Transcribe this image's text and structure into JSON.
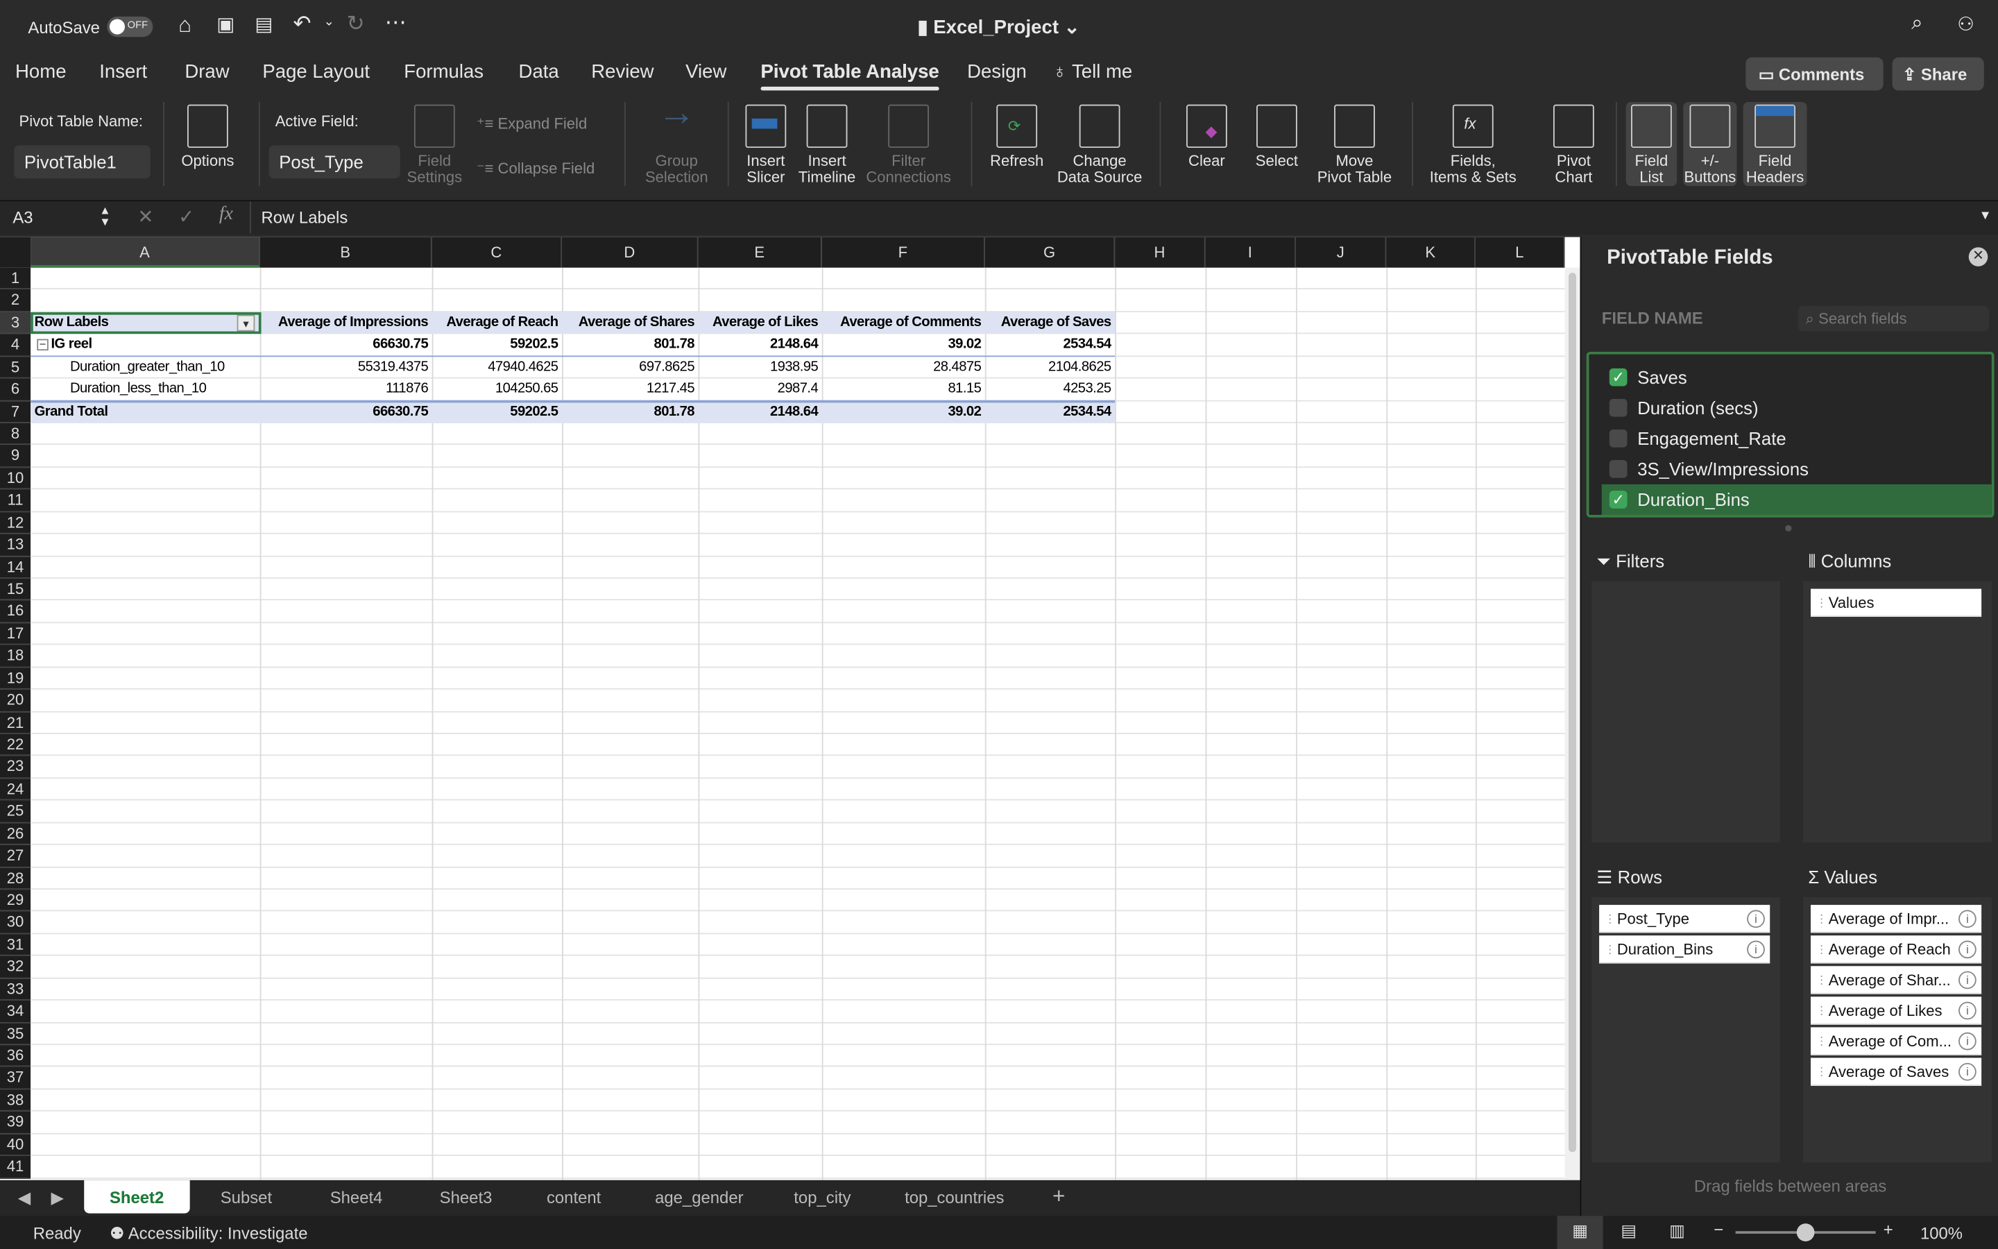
{
  "titlebar": {
    "autosave": "AutoSave",
    "autosave_state": "OFF",
    "filename": "Excel_Project"
  },
  "tabs": [
    "Home",
    "Insert",
    "Draw",
    "Page Layout",
    "Formulas",
    "Data",
    "Review",
    "View",
    "Pivot Table Analyse",
    "Design",
    "Tell me"
  ],
  "active_tab": "Pivot Table Analyse",
  "buttons": {
    "comments": "Comments",
    "share": "Share"
  },
  "ribbon": {
    "pivot_name_label": "Pivot Table Name:",
    "pivot_name": "PivotTable1",
    "options": "Options",
    "active_field_label": "Active Field:",
    "active_field": "Post_Type",
    "field_settings": "Field\nSettings",
    "expand_field": "Expand Field",
    "collapse_field": "Collapse Field",
    "group_selection": "Group\nSelection",
    "insert_slicer": "Insert\nSlicer",
    "insert_timeline": "Insert\nTimeline",
    "filter_connections": "Filter\nConnections",
    "refresh": "Refresh",
    "change_source": "Change\nData Source",
    "clear": "Clear",
    "select": "Select",
    "move": "Move\nPivot Table",
    "fields_items": "Fields,\nItems & Sets",
    "pivot_chart": "Pivot\nChart",
    "field_list": "Field\nList",
    "buttons": "+/-\nButtons",
    "field_headers": "Field\nHeaders"
  },
  "formula_bar": {
    "name_box": "A3",
    "formula": "Row Labels"
  },
  "columns": [
    "A",
    "B",
    "C",
    "D",
    "E",
    "F",
    "G",
    "H",
    "I",
    "J",
    "K",
    "L"
  ],
  "row_count": 41,
  "pivot": {
    "headers": [
      "Row Labels",
      "Average of Impressions",
      "Average of Reach",
      "Average of Shares",
      "Average of Likes",
      "Average of Comments",
      "Average of Saves"
    ],
    "rows": [
      {
        "label": "IG reel",
        "values": [
          "66630.75",
          "59202.5",
          "801.78",
          "2148.64",
          "39.02",
          "2534.54"
        ],
        "level": 0
      },
      {
        "label": "Duration_greater_than_10",
        "values": [
          "55319.4375",
          "47940.4625",
          "697.8625",
          "1938.95",
          "28.4875",
          "2104.8625"
        ],
        "level": 1
      },
      {
        "label": "Duration_less_than_10",
        "values": [
          "111876",
          "104250.65",
          "1217.45",
          "2987.4",
          "81.15",
          "4253.25"
        ],
        "level": 1
      },
      {
        "label": "Grand Total",
        "values": [
          "66630.75",
          "59202.5",
          "801.78",
          "2148.64",
          "39.02",
          "2534.54"
        ],
        "level": 0
      }
    ]
  },
  "sheets": [
    "Sheet2",
    "Subset",
    "Sheet4",
    "Sheet3",
    "content",
    "age_gender",
    "top_city",
    "top_countries"
  ],
  "active_sheet": "Sheet2",
  "status": {
    "ready": "Ready",
    "accessibility": "Accessibility: Investigate",
    "zoom": "100%"
  },
  "panel": {
    "title": "PivotTable Fields",
    "field_name": "FIELD NAME",
    "search_placeholder": "Search fields",
    "fields": [
      {
        "name": "Saves",
        "checked": true
      },
      {
        "name": "Duration (secs)",
        "checked": false
      },
      {
        "name": "Engagement_Rate",
        "checked": false
      },
      {
        "name": "3S_View/Impressions",
        "checked": false
      },
      {
        "name": "Duration_Bins",
        "checked": true
      }
    ],
    "filters": "Filters",
    "columns": "Columns",
    "rows": "Rows",
    "values": "Values",
    "columns_items": [
      "Values"
    ],
    "rows_items": [
      "Post_Type",
      "Duration_Bins"
    ],
    "values_items": [
      "Average of Impr...",
      "Average of Reach",
      "Average of Shar...",
      "Average of Likes",
      "Average of Com...",
      "Average of Saves"
    ],
    "footer": "Drag fields between areas"
  },
  "colors": {
    "accent": "#3fa55a",
    "pivot_header": "#dde3f2",
    "selection": "#2f7d45"
  }
}
